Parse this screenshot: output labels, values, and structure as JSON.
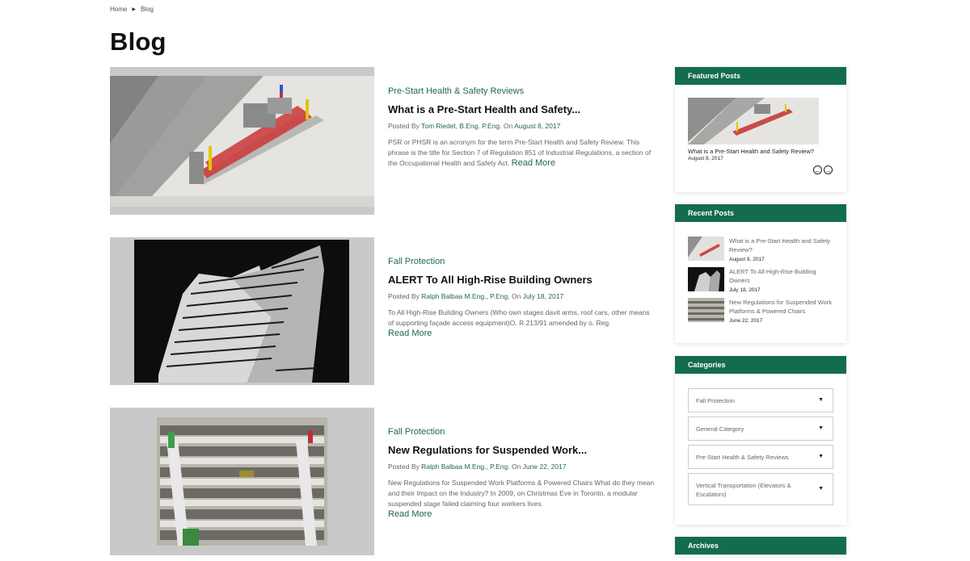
{
  "breadcrumb": {
    "home": "Home",
    "current": "Blog"
  },
  "page_title": "Blog",
  "posts": [
    {
      "category": "Pre-Start Health & Safety Reviews",
      "title": "What is a Pre-Start Health and Safety...",
      "posted_by": "Posted By",
      "author": "Tom Riedel, B.Eng. P.Eng.",
      "on": "On",
      "date": "August 8, 2017",
      "excerpt": "PSR or PHSR is an acronym for the term Pre-Start Health and Safety Review. This phrase is the title for Section 7 of Regulation 851 of Industrial Regulations, a section of the Occupational Health and Safety Act.",
      "read_more": "Read More"
    },
    {
      "category": "Fall Protection",
      "title": "ALERT To All High-Rise Building Owners",
      "posted_by": "Posted By",
      "author": "Ralph Balbaa M.Eng., P.Eng.",
      "on": "On",
      "date": "July 18, 2017",
      "excerpt": "To All High-Rise Building Owners (Who own stages davit arms, roof cars, other means of supporting façade access equipment)O. R.213/91 amended by o. Reg.",
      "read_more": "Read More"
    },
    {
      "category": "Fall Protection",
      "title": "New Regulations for Suspended Work...",
      "posted_by": "Posted By",
      "author": "Ralph Balbaa M.Eng., P.Eng.",
      "on": "On",
      "date": "June 22, 2017",
      "excerpt": "New Regulations for Suspended Work Platforms & Powered Chairs What do they mean and their Impact on the Industry? In 2009, on Christmas Eve in Toronto, a modular suspended stage failed claiming four workers lives.",
      "read_more": "Read More"
    }
  ],
  "sidebar": {
    "featured": {
      "heading": "Featured Posts",
      "title": "What is a Pre-Start Health and Safety Review?",
      "date": "August 8, 2017"
    },
    "recent": {
      "heading": "Recent Posts",
      "items": [
        {
          "title": "What is a Pre-Start Health and Safety Review?",
          "date": "August 8, 2017"
        },
        {
          "title": "ALERT To All High-Rise Building Owners",
          "date": "July 18, 2017"
        },
        {
          "title": "New Regulations for Suspended Work Platforms & Powered Chairs",
          "date": "June 22, 2017"
        }
      ]
    },
    "categories": {
      "heading": "Categories",
      "items": [
        "Fall Protection",
        "General Category",
        "Pre-Start Health & Safety Reviews",
        "Vertical Transportation (Elevators & Escalators)"
      ]
    },
    "archives": {
      "heading": "Archives"
    }
  },
  "colors": {
    "brand_green": "#146c4f",
    "link_green": "#1f6b45"
  },
  "icons": {
    "breadcrumb_separator": "caret-right-icon",
    "dropdown": "caret-down-icon",
    "prev": "arrow-left-circle-icon",
    "next": "arrow-right-circle-icon"
  }
}
